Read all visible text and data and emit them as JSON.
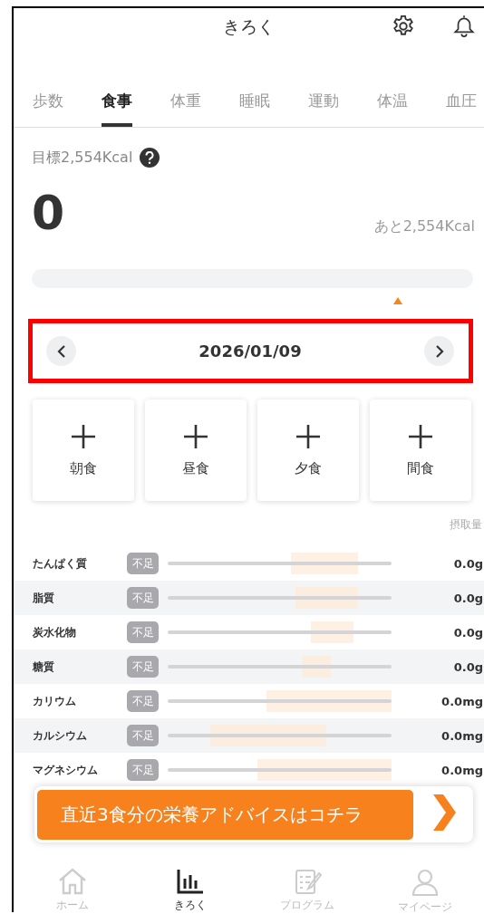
{
  "header": {
    "title": "きろく"
  },
  "tabs": [
    {
      "label": "歩数",
      "selected": false
    },
    {
      "label": "食事",
      "selected": true
    },
    {
      "label": "体重",
      "selected": false
    },
    {
      "label": "睡眠",
      "selected": false
    },
    {
      "label": "運動",
      "selected": false
    },
    {
      "label": "体温",
      "selected": false
    },
    {
      "label": "血圧",
      "selected": false
    }
  ],
  "calories": {
    "goal": "目標2,554Kcal",
    "intake": "0",
    "remaining": "あと2,554Kcal",
    "level": 0
  },
  "date_nav": {
    "date": "2026/01/09",
    "highlighted": true
  },
  "meals": [
    {
      "label": "朝食"
    },
    {
      "label": "昼食"
    },
    {
      "label": "夕食"
    },
    {
      "label": "間食"
    }
  ],
  "nutrients": {
    "header": "摂取量",
    "rows": [
      {
        "name": "たんぱく質",
        "status": "不足",
        "value": "0.0g"
      },
      {
        "name": "脂質",
        "status": "不足",
        "value": "0.0g"
      },
      {
        "name": "炭水化物",
        "status": "不足",
        "value": "0.0g"
      },
      {
        "name": "糖質",
        "status": "不足",
        "value": "0.0g"
      },
      {
        "name": "カリウム",
        "status": "不足",
        "value": "0.0mg"
      },
      {
        "name": "カルシウム",
        "status": "不足",
        "value": "0.0mg"
      },
      {
        "name": "マグネシウム",
        "status": "不足",
        "value": "0.0mg"
      }
    ]
  },
  "advice_banner": {
    "label": "直近3食分の栄養アドバイスはコチラ"
  },
  "bottom_nav": [
    {
      "label": "ホーム",
      "selected": false
    },
    {
      "label": "きろく",
      "selected": true
    },
    {
      "label": "プログラム",
      "selected": false
    },
    {
      "label": "マイページ",
      "selected": false
    }
  ]
}
